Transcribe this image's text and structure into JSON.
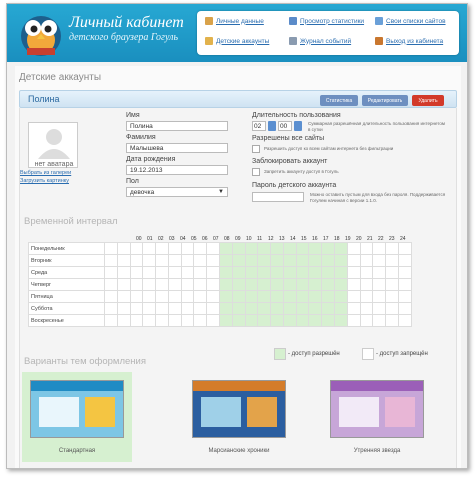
{
  "header": {
    "brand_title": "Личный кабинет",
    "brand_subtitle": "детского браузера Гогуль",
    "menu": [
      {
        "label": "Личные данные",
        "icon": "user-icon",
        "color": "#d9a24a"
      },
      {
        "label": "Просмотр статистики",
        "icon": "statistics-icon",
        "color": "#5b8bc9"
      },
      {
        "label": "Свои списки сайтов",
        "icon": "list-icon",
        "color": "#6aa0d8"
      },
      {
        "label": "Детские аккаунты",
        "icon": "children-icon",
        "color": "#e2b24c"
      },
      {
        "label": "Журнал событий",
        "icon": "journal-icon",
        "color": "#8a9bb0"
      },
      {
        "label": "Выход из кабинета",
        "icon": "exit-icon",
        "color": "#c9772f"
      }
    ]
  },
  "page_title": "Детские аккаунты",
  "child": {
    "name": "Полина",
    "buttons": {
      "stats": "Статистика",
      "edit": "Редактировать",
      "delete": "Удалить"
    },
    "avatar_caption": "нет аватара",
    "choose_gallery": "Выбрать из галереи",
    "upload_picture": "Загрузить картинку",
    "fields": {
      "name_label": "Имя",
      "name_value": "Полина",
      "surname_label": "Фамилия",
      "surname_value": "Малышева",
      "birth_label": "Дата рождения",
      "birth_value": "19.12.2013",
      "gender_label": "Пол",
      "gender_value": "девочка"
    },
    "duration": {
      "label": "Длительность пользования",
      "hours": "02",
      "minutes": "00",
      "note": "Суммарная разрешённая длительность пользования интернетом в сутки"
    },
    "allow_all": {
      "label": "Разрешены все сайты",
      "checkbox_text": "Разрешить доступ ко всем сайтам интернета без фильтрации"
    },
    "block": {
      "label": "Заблокировать аккаунт",
      "checkbox_text": "Запретить аккаунту доступ в Гогуль"
    },
    "password": {
      "label": "Пароль детского аккаунта",
      "note": "Можно оставить пустым для входа без пароля. Поддерживается Гогулем начиная с версии 1.1.0."
    }
  },
  "schedule": {
    "title": "Временной интервал",
    "hours": [
      "00",
      "01",
      "02",
      "03",
      "04",
      "05",
      "06",
      "07",
      "08",
      "09",
      "10",
      "11",
      "12",
      "13",
      "14",
      "15",
      "16",
      "17",
      "18",
      "19",
      "20",
      "21",
      "22",
      "23",
      "24"
    ],
    "days": [
      "Понедельник",
      "Вторник",
      "Среда",
      "Четверг",
      "Пятница",
      "Суббота",
      "Воскресенье"
    ],
    "allowed_from": 9,
    "allowed_to": 19,
    "legend_allowed": "- доступ разрешён",
    "legend_denied": "- доступ запрещён",
    "allowed_color": "#d6f0d0"
  },
  "themes": {
    "title": "Варианты тем оформления",
    "items": [
      {
        "name": "Стандартная",
        "selected": true
      },
      {
        "name": "Марсианские хроники",
        "selected": false
      },
      {
        "name": "Утренняя звезда",
        "selected": false
      }
    ]
  }
}
